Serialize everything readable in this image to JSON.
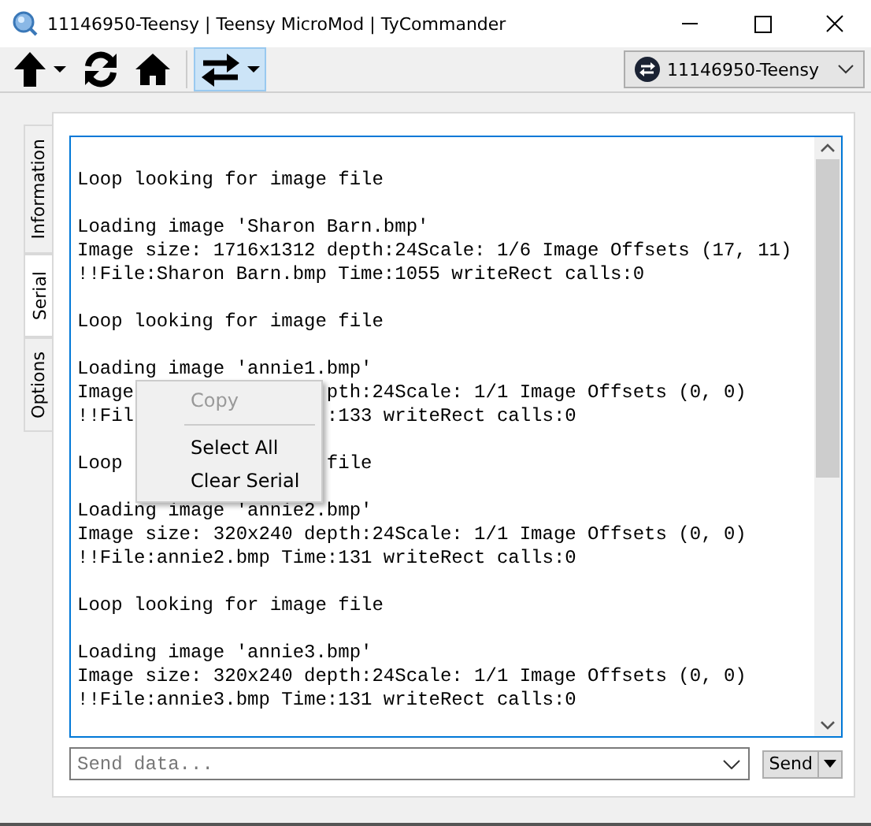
{
  "window": {
    "title": "11146950-Teensy | Teensy MicroMod | TyCommander"
  },
  "toolbar": {
    "buttons": [
      {
        "kind": "upload",
        "menu": true,
        "selected": false
      },
      {
        "kind": "reset",
        "menu": false,
        "selected": false
      },
      {
        "kind": "bootloader",
        "menu": false,
        "selected": false
      },
      {
        "kind": "serial",
        "menu": true,
        "selected": true
      }
    ],
    "board_select": {
      "value": "11146950-Teensy"
    }
  },
  "tabs": [
    {
      "label": "Information",
      "selected": false
    },
    {
      "label": "Serial",
      "selected": true
    },
    {
      "label": "Options",
      "selected": false
    }
  ],
  "serial_log": {
    "paragraphs": [
      [
        [
          "Loop looking for image file"
        ]
      ],
      [
        [
          "Loading image 'Sharon Barn.bmp'"
        ],
        [
          "Image size: 1716x1312 depth:24Scale: 1/6 Image Offsets (17, 11)"
        ],
        [
          "!!File:Sharon Barn.bmp Time:1055 writeRect calls:0"
        ]
      ],
      [
        [
          "Loop looking for image file"
        ]
      ],
      [
        [
          "Loading image 'annie1.bmp'"
        ],
        [
          "Image",
          "pth:24Scale: 1/1 Image Offsets (0, 0)"
        ],
        [
          "!!Fil",
          ":133 writeRect calls:0"
        ]
      ],
      [
        [
          "Loop",
          "file"
        ]
      ],
      [
        [
          "Loading image 'annie2.bmp'"
        ],
        [
          "Image size: 320x240 depth:24Scale: 1/1 Image Offsets (0, 0)"
        ],
        [
          "!!File:annie2.bmp Time:131 writeRect calls:0"
        ]
      ],
      [
        [
          "Loop looking for image file"
        ]
      ],
      [
        [
          "Loading image 'annie3.bmp'"
        ],
        [
          "Image size: 320x240 depth:24Scale: 1/1 Image Offsets (0, 0)"
        ],
        [
          "!!File:annie3.bmp Time:131 writeRect calls:0"
        ]
      ]
    ]
  },
  "context_menu": [
    {
      "label": "Copy",
      "disabled": true,
      "separator_after": true
    },
    {
      "label": "Select All",
      "disabled": false,
      "separator_after": false
    },
    {
      "label": "Clear Serial",
      "disabled": false,
      "separator_after": false
    }
  ],
  "send_field": {
    "placeholder": "Send data..."
  },
  "send_button": {
    "label": "Send"
  }
}
